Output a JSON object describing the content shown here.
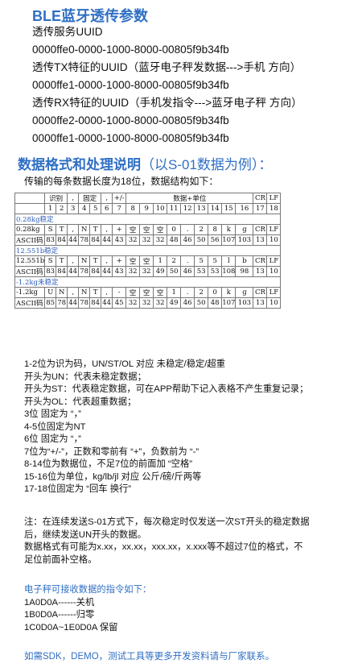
{
  "ble": {
    "title": "BLE蓝牙透传参数",
    "lines": [
      "透传服务UUID",
      "0000ffe0-0000-1000-8000-00805f9b34fb",
      "透传TX特征的UUID（蓝牙电子秤发数据--->手机 方向）",
      "0000ffe1-0000-1000-8000-00805f9b34fb",
      "透传RX特征的UUID（手机发指令--->蓝牙电子秤 方向）",
      "0000ffe2-0000-1000-8000-00805f9b34fb",
      "0000ffe1-0000-1000-8000-00805f9b34fb"
    ]
  },
  "format": {
    "title_main": "数据格式和处理说明",
    "title_paren": "（以S-01数据为例）：",
    "subtitle": "传输的每条数据长度为18位，数据结构如下：",
    "table": {
      "header1": [
        "识别",
        ",",
        "固定",
        ",",
        "+/-",
        "数据+单位",
        "CR",
        "LF"
      ],
      "header_nums": [
        "1",
        "2",
        "3",
        "4",
        "5",
        "6",
        "7",
        "8",
        "9",
        "10",
        "11",
        "12",
        "13",
        "14",
        "15",
        "16",
        "17",
        "18"
      ],
      "sections": [
        {
          "label": "0.28kg稳定",
          "rows": [
            [
              "0.28kg",
              "S",
              "T",
              ",",
              "N",
              "T",
              ",",
              "+",
              "空",
              "空",
              "空",
              "0",
              ".",
              "2",
              "8",
              "k",
              "g",
              "CR",
              "LF"
            ],
            [
              "ASCII码",
              "83",
              "84",
              "44",
              "78",
              "84",
              "44",
              "43",
              "32",
              "32",
              "32",
              "48",
              "46",
              "50",
              "56",
              "107",
              "103",
              "13",
              "10"
            ]
          ]
        },
        {
          "label": "12.551b稳定",
          "rows": [
            [
              "12.551b",
              "S",
              "T",
              ",",
              "N",
              "T",
              ",",
              "+",
              "空",
              "空",
              "1",
              "2",
              ".",
              "5",
              "5",
              "l",
              "b",
              "CR",
              "LF"
            ],
            [
              "ASCII码",
              "83",
              "84",
              "44",
              "78",
              "84",
              "44",
              "43",
              "32",
              "32",
              "49",
              "50",
              "46",
              "53",
              "53",
              "108",
              "98",
              "13",
              "10"
            ]
          ]
        },
        {
          "label": "-1.2kg未稳定",
          "rows": [
            [
              "-1.2kg",
              "U",
              "N",
              ",",
              "N",
              "T",
              ",",
              "-",
              "空",
              "空",
              "空",
              "1",
              ".",
              "2",
              "0",
              "k",
              "g",
              "CR",
              "LF"
            ],
            [
              "ASCII码",
              "85",
              "78",
              "44",
              "78",
              "84",
              "44",
              "45",
              "32",
              "32",
              "32",
              "49",
              "46",
              "50",
              "48",
              "107",
              "103",
              "13",
              "10"
            ]
          ]
        }
      ]
    },
    "legend": [
      "1-2位为识为码，UN/ST/OL 对应 未稳定/稳定/超重",
      "开头为UN：代表未稳定数据；",
      "开头为ST：代表稳定数据，可在APP帮助下记入表格不产生重复记录；",
      "开头为OL：代表超重数据；",
      "3位 固定为 “，”",
      "4-5位固定为NT",
      "6位 固定为 “，”",
      "7位为“+/-”，正数和零前有 “+”，负数前为 “-”",
      "8-14位为数据位，不足7位的前面加 “空格”",
      "15-16位为单位，kg/lb/jl 对应 公斤/磅/斤两等",
      "17-18位固定为 “回车 换行”"
    ],
    "notes": [
      "注：在连续发送S-01方式下，每次稳定时仅发送一次ST开头的稳定数据",
      "后，继续发送UN开头的数据。",
      "数据格式有可能为x.xx，xx.xx，xxx.xx，x.xxx等不超过7位的格式，不",
      "足位前面补空格。"
    ]
  },
  "commands": {
    "heading": "电子秤可接收数据的指令如下：",
    "items": [
      "1A0D0A------关机",
      "1B0D0A------归零",
      "1C0D0A~1E0D0A 保留"
    ]
  },
  "footer": "如需SDK，DEMO，测试工具等更多开发资料请与厂家联系。",
  "colors": {
    "accent": "#2f6fc4",
    "table_label": "#2a5bb8"
  }
}
